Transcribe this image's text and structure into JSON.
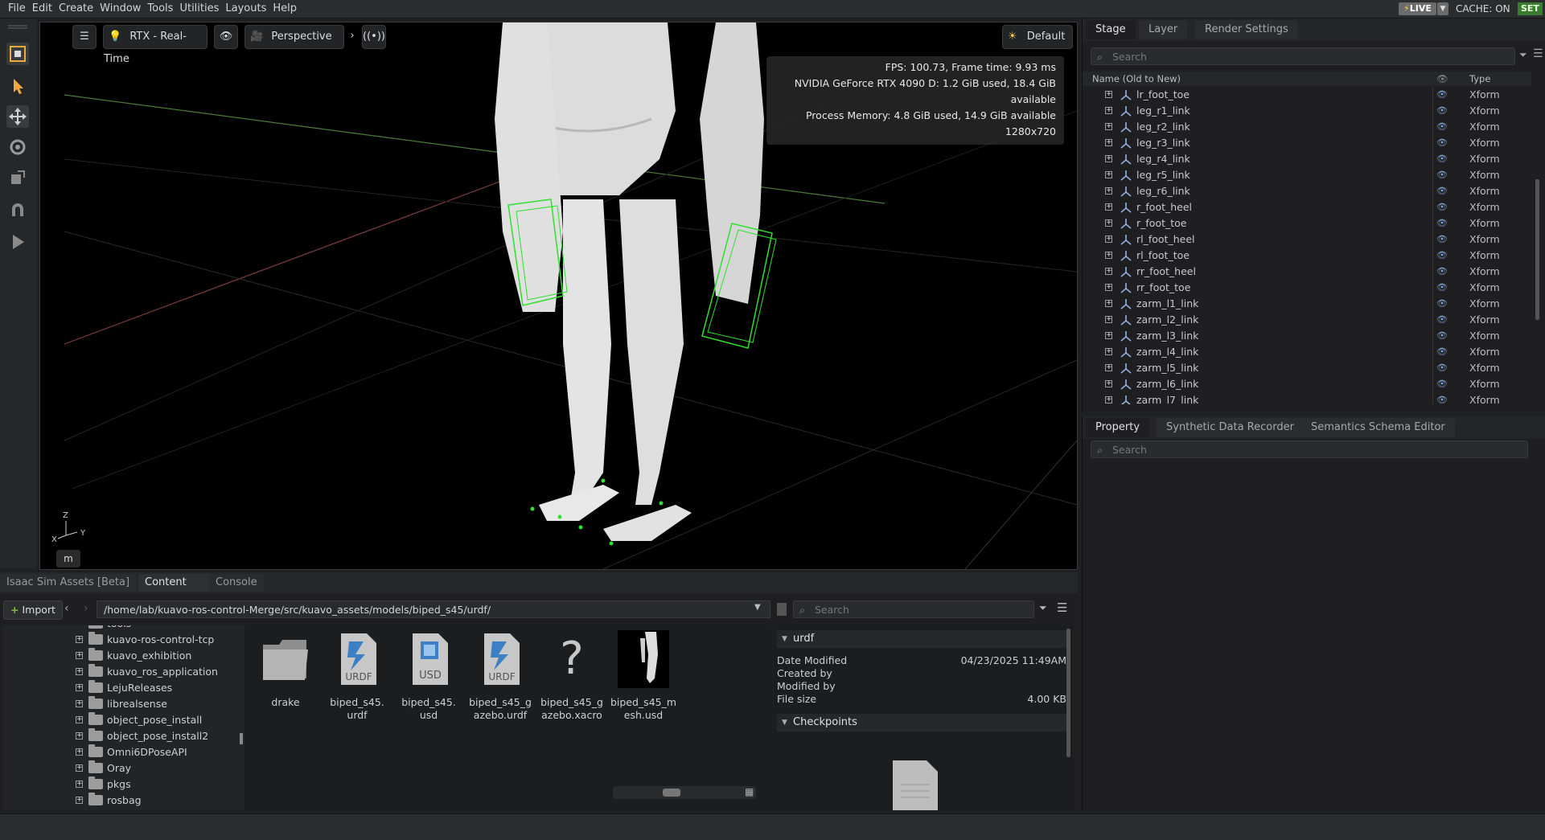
{
  "menubar": {
    "items": [
      "File",
      "Edit",
      "Create",
      "Window",
      "Tools",
      "Utilities",
      "Layouts",
      "Help"
    ],
    "live_label": "LIVE",
    "cache_label": "CACHE: ON",
    "set_label": "SET"
  },
  "viewport": {
    "render_mode": "RTX - Real-Time",
    "camera": "Perspective",
    "lighting": "Default",
    "stats": {
      "fps": "FPS: 100.73, Frame time: 9.93 ms",
      "gpu": "NVIDIA GeForce RTX 4090 D: 1.2 GiB used, 18.4 GiB available",
      "memory": "Process Memory: 4.8 GiB used, 14.9 GiB available",
      "resolution": "1280x720"
    },
    "axis": {
      "z": "Z",
      "x": "X",
      "y": "Y"
    },
    "unit": "m"
  },
  "stage": {
    "tabs": [
      "Stage",
      "Layer",
      "Render Settings"
    ],
    "search_placeholder": "Search",
    "column_name": "Name (Old to New)",
    "column_type": "Type",
    "rows": [
      {
        "name": "lr_foot_toe",
        "type": "Xform"
      },
      {
        "name": "leg_r1_link",
        "type": "Xform"
      },
      {
        "name": "leg_r2_link",
        "type": "Xform"
      },
      {
        "name": "leg_r3_link",
        "type": "Xform"
      },
      {
        "name": "leg_r4_link",
        "type": "Xform"
      },
      {
        "name": "leg_r5_link",
        "type": "Xform"
      },
      {
        "name": "leg_r6_link",
        "type": "Xform"
      },
      {
        "name": "r_foot_heel",
        "type": "Xform"
      },
      {
        "name": "r_foot_toe",
        "type": "Xform"
      },
      {
        "name": "rl_foot_heel",
        "type": "Xform"
      },
      {
        "name": "rl_foot_toe",
        "type": "Xform"
      },
      {
        "name": "rr_foot_heel",
        "type": "Xform"
      },
      {
        "name": "rr_foot_toe",
        "type": "Xform"
      },
      {
        "name": "zarm_l1_link",
        "type": "Xform"
      },
      {
        "name": "zarm_l2_link",
        "type": "Xform"
      },
      {
        "name": "zarm_l3_link",
        "type": "Xform"
      },
      {
        "name": "zarm_l4_link",
        "type": "Xform"
      },
      {
        "name": "zarm_l5_link",
        "type": "Xform"
      },
      {
        "name": "zarm_l6_link",
        "type": "Xform"
      },
      {
        "name": "zarm_l7_link",
        "type": "Xform"
      }
    ]
  },
  "property": {
    "tabs": [
      "Property",
      "Synthetic Data Recorder",
      "Semantics Schema Editor"
    ],
    "search_placeholder": "Search"
  },
  "content": {
    "tabs": [
      "Isaac Sim Assets [Beta]",
      "Content",
      "Console"
    ],
    "import_label": "Import",
    "path": "/home/lab/kuavo-ros-control-Merge/src/kuavo_assets/models/biped_s45/urdf/",
    "search_placeholder": "Search",
    "tree": [
      "tools",
      "kuavo-ros-control-tcp",
      "kuavo_exhibition",
      "kuavo_ros_application",
      "LejuReleases",
      "librealsense",
      "object_pose_install",
      "object_pose_install2",
      "Omni6DPoseAPI",
      "Oray",
      "pkgs",
      "rosbag"
    ],
    "files": [
      {
        "line1": "drake",
        "line2": "",
        "icon": "folder-icon"
      },
      {
        "line1": "biped_s45.",
        "line2": "urdf",
        "icon": "urdf-file-icon"
      },
      {
        "line1": "biped_s45.",
        "line2": "usd",
        "icon": "usd-file-icon"
      },
      {
        "line1": "biped_s45_g",
        "line2": "azebo.urdf",
        "icon": "urdf-file-icon"
      },
      {
        "line1": "biped_s45_g",
        "line2": "azebo.xacro",
        "icon": "unknown-file-icon"
      },
      {
        "line1": "biped_s45_m",
        "line2": "esh.usd",
        "icon": "robot-thumbnail"
      }
    ],
    "details": {
      "section_title": "urdf",
      "date_modified_label": "Date Modified",
      "date_modified_value": "04/23/2025 11:49AM",
      "created_by_label": "Created by",
      "modified_by_label": "Modified by",
      "file_size_label": "File size",
      "file_size_value": "4.00 KB",
      "checkpoints_label": "Checkpoints"
    }
  }
}
